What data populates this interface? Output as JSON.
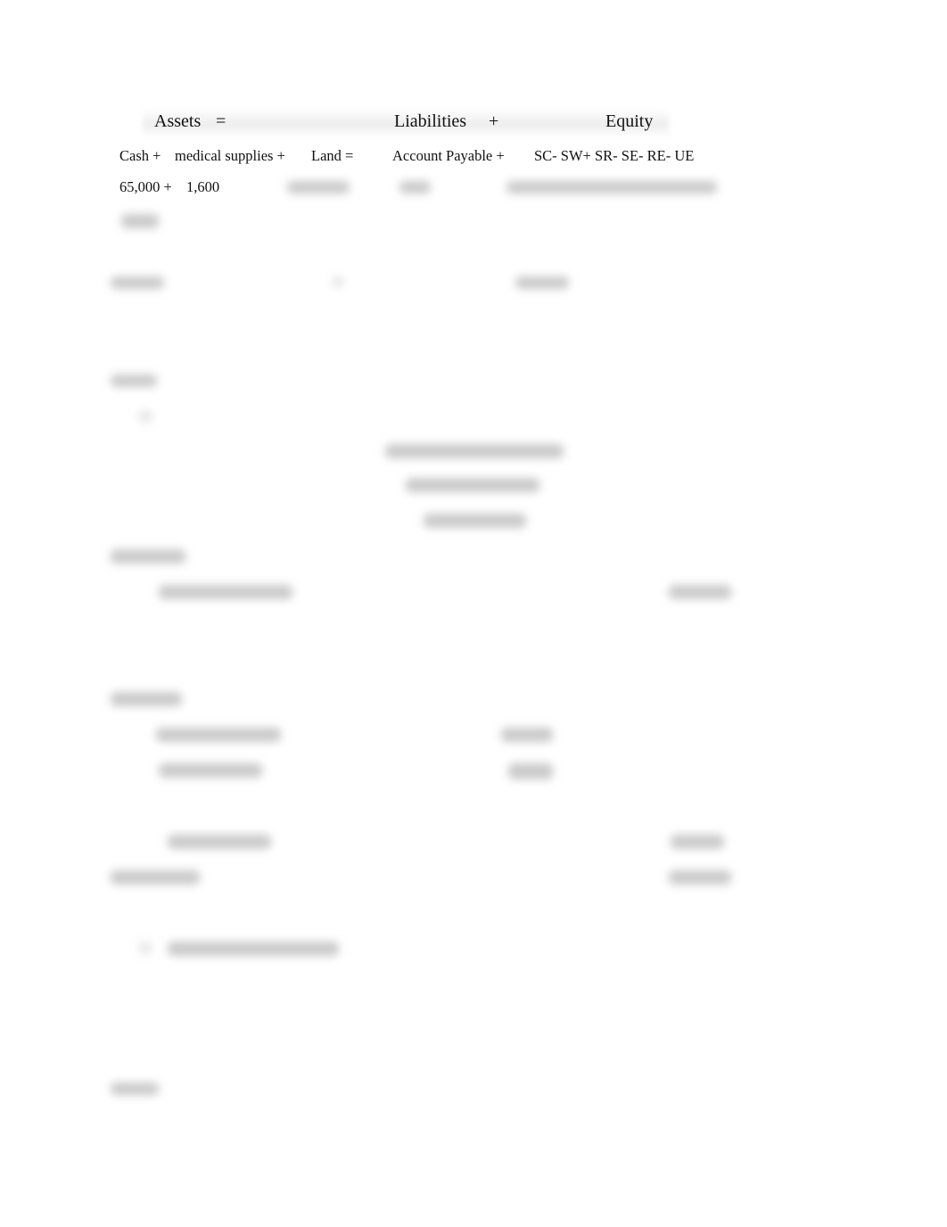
{
  "equation_header": {
    "assets": "Assets",
    "eq": "=",
    "liabilities": "Liabilities",
    "plus": "+",
    "equity": "Equity"
  },
  "accounts_row": {
    "cash": "Cash +",
    "medical_supplies": "medical supplies +",
    "land": "Land =",
    "accounts_payable": "Account Payable +",
    "equity_terms": "SC- SW+ SR- SE- RE- UE"
  },
  "values_row": {
    "cash": "65,000 +",
    "medical_supplies": "1,600"
  },
  "blurred_content_note": "Remaining document content is blurred and illegible"
}
